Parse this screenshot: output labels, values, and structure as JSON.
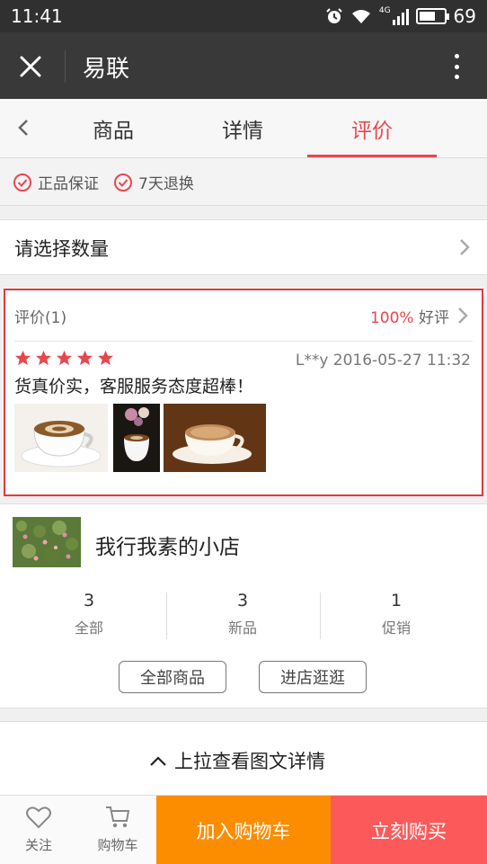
{
  "status_bar": {
    "time": "11:41",
    "battery": "69",
    "network": "4G",
    "battery_level": 0.69
  },
  "title_bar": {
    "title": "易联"
  },
  "tabs": [
    {
      "label": "商品",
      "active": false
    },
    {
      "label": "详情",
      "active": false
    },
    {
      "label": "评价",
      "active": true
    }
  ],
  "guarantees": [
    "正品保证",
    "7天退换"
  ],
  "quantity": {
    "label": "请选择数量"
  },
  "review": {
    "header": "评价(1)",
    "rate_pct": "100%",
    "rate_label": "好评",
    "stars": 5,
    "user": "L**y",
    "datetime": "2016-05-27 11:32",
    "text": "货真价实，客服服务态度超棒！",
    "photos": [
      "latte-art-coffee-photo",
      "coffee-cup-with-flowers-photo",
      "cappuccino-photo"
    ]
  },
  "shop": {
    "name": "我行我素的小店",
    "stats": [
      {
        "value": "3",
        "label": "全部"
      },
      {
        "value": "3",
        "label": "新品"
      },
      {
        "value": "1",
        "label": "促销"
      }
    ],
    "all_products_label": "全部商品",
    "visit_label": "进店逛逛"
  },
  "pullup": {
    "label": "上拉查看图文详情"
  },
  "bottom_bar": {
    "follow_label": "关注",
    "cart_label": "购物车",
    "add_to_cart_label": "加入购物车",
    "buy_now_label": "立刻购买"
  },
  "colors": {
    "accent": "#e8474e",
    "cart_button": "#fc8c00",
    "buy_button": "#fc5a5a",
    "title_bar": "#393939"
  }
}
